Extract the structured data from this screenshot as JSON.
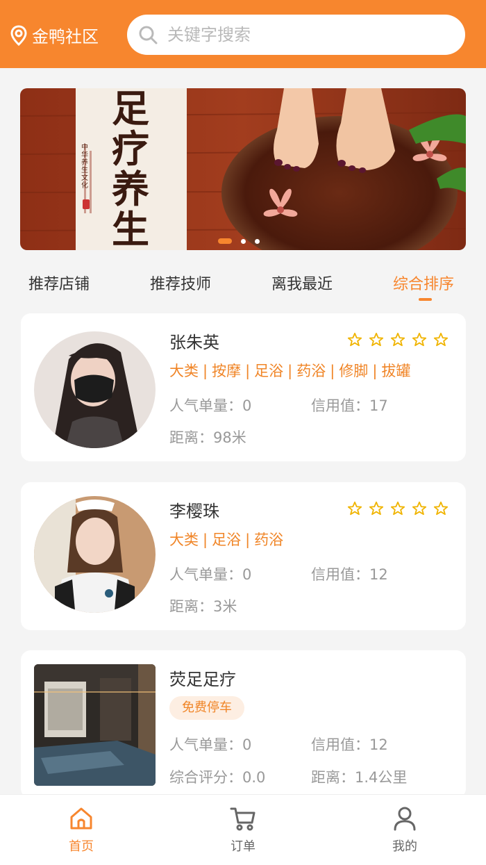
{
  "header": {
    "location": "金鸭社区",
    "search_placeholder": "关键字搜索"
  },
  "banner": {
    "title_text": "足疗养生",
    "subtitle_text": "中华养生文化",
    "dot_count": 3,
    "active_dot": 0
  },
  "tabs": [
    {
      "label": "推荐店铺"
    },
    {
      "label": "推荐技师"
    },
    {
      "label": "离我最近"
    },
    {
      "label": "综合排序"
    }
  ],
  "technicians": [
    {
      "name": "张朱英",
      "stars": 5,
      "tags": [
        "大类",
        "按摩",
        "足浴",
        "药浴",
        "修脚",
        "拔罐"
      ],
      "orders": "人气单量：0",
      "credit": "信用值：17",
      "distance": "距离：98米"
    },
    {
      "name": "李樱珠",
      "stars": 5,
      "tags": [
        "大类",
        "足浴",
        "药浴"
      ],
      "orders": "人气单量：0",
      "credit": "信用值：12",
      "distance": "距离：3米"
    }
  ],
  "shop": {
    "name": "荧足足疗",
    "chip": "免费停车",
    "orders": "人气单量：0",
    "credit": "信用值：12",
    "rating": "综合评分：0.0",
    "distance": "距离：1.4公里"
  },
  "bottom_nav": [
    {
      "label": "首页",
      "icon": "home-icon"
    },
    {
      "label": "订单",
      "icon": "cart-icon"
    },
    {
      "label": "我的",
      "icon": "user-icon"
    }
  ],
  "colors": {
    "accent": "#f7862e",
    "tag": "#f08527",
    "background": "#f4f4f4"
  }
}
